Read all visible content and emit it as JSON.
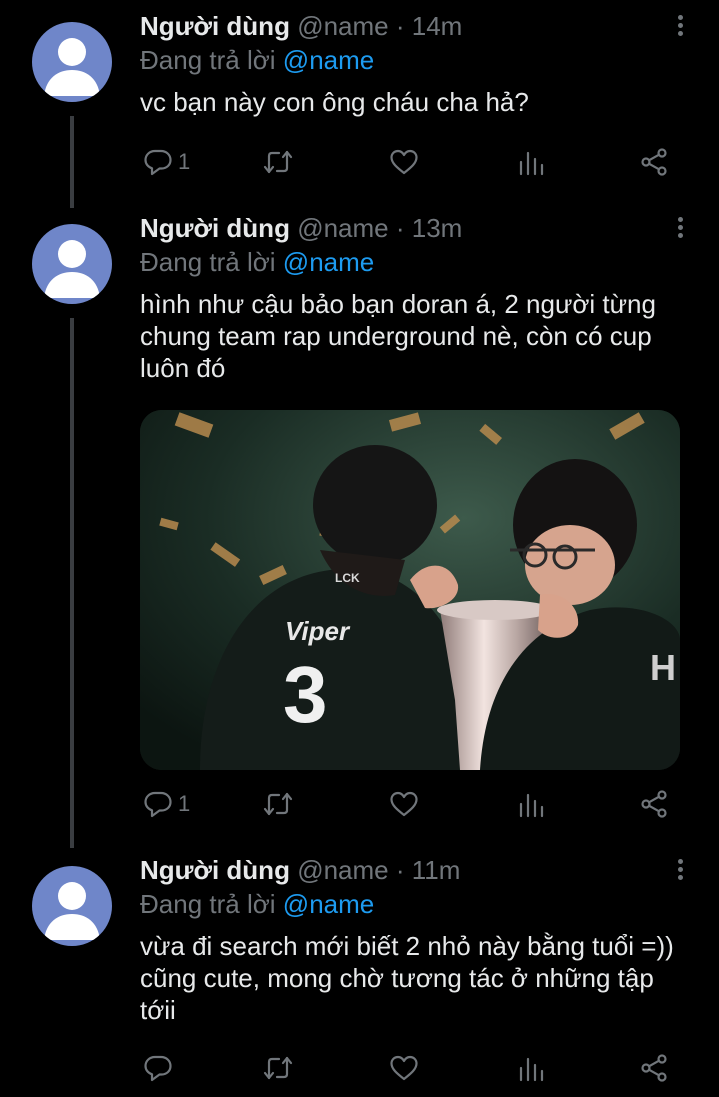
{
  "tweets": [
    {
      "display_name": "Người dùng",
      "handle": "@name",
      "separator": "·",
      "time": "14m",
      "replying_prefix": "Đang trả lời",
      "replying_to": "@name",
      "text": "vc bạn này con ông cháu cha hả?",
      "reply_count": "1"
    },
    {
      "display_name": "Người dùng",
      "handle": "@name",
      "separator": "·",
      "time": "13m",
      "replying_prefix": "Đang trả lời",
      "replying_to": "@name",
      "text": "hình như cậu bảo bạn doran á, 2 người từng chung team rap underground nè, còn có cup luôn đó",
      "reply_count": "1",
      "media": {
        "jersey_name": "Viper",
        "jersey_number": "3",
        "jersey_brand": "LCK"
      }
    },
    {
      "display_name": "Người dùng",
      "handle": "@name",
      "separator": "·",
      "time": "11m",
      "replying_prefix": "Đang trả lời",
      "replying_to": "@name",
      "text": "vừa đi search mới biết 2 nhỏ này bằng tuổi =)) cũng cute, mong chờ tương tác ở những tập tớii",
      "reply_count": ""
    }
  ],
  "icons": {
    "reply": "reply-icon",
    "retweet": "retweet-icon",
    "like": "heart-icon",
    "views": "views-icon",
    "share": "share-icon",
    "more": "more-icon"
  },
  "colors": {
    "background": "#000000",
    "text": "#e7e9ea",
    "muted": "#71767b",
    "mention": "#1d9bf0",
    "avatar": "#6f86c9"
  }
}
